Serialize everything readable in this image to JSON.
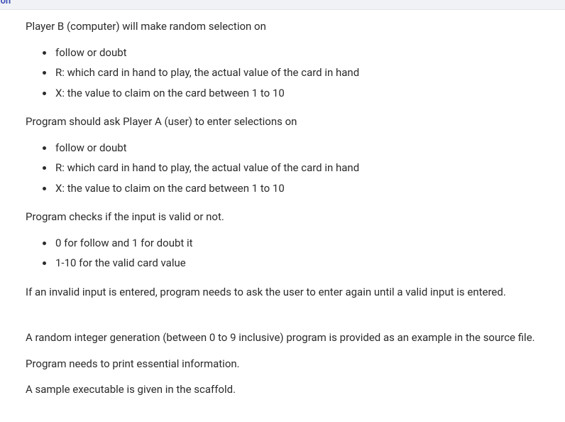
{
  "header": {
    "truncated_label": "iption"
  },
  "paragraphs": {
    "p1": "Player B (computer) will make random selection on",
    "p2": "Program should ask Player A (user) to enter selections on",
    "p3": "Program checks if the input is valid or not.",
    "p4": "If an invalid input is entered, program needs to ask the user to enter again until a valid input is entered.",
    "p5": "A random integer generation (between 0 to 9 inclusive) program is provided as an example in the source file.",
    "p6": "Program needs to print essential information.",
    "p7": "A sample executable is given in the scaffold."
  },
  "list1": {
    "item1": "follow or doubt",
    "item2": "R: which card in hand to play, the actual value of the card in hand",
    "item3": "X: the value to claim on the card between 1 to 10"
  },
  "list2": {
    "item1": "follow or doubt",
    "item2": "R: which card in hand to play, the actual value of the card in hand",
    "item3": "X: the value to claim on the card between 1 to 10"
  },
  "list3": {
    "item1": "0 for follow and 1 for doubt it",
    "item2": "1-10 for the valid card value"
  }
}
